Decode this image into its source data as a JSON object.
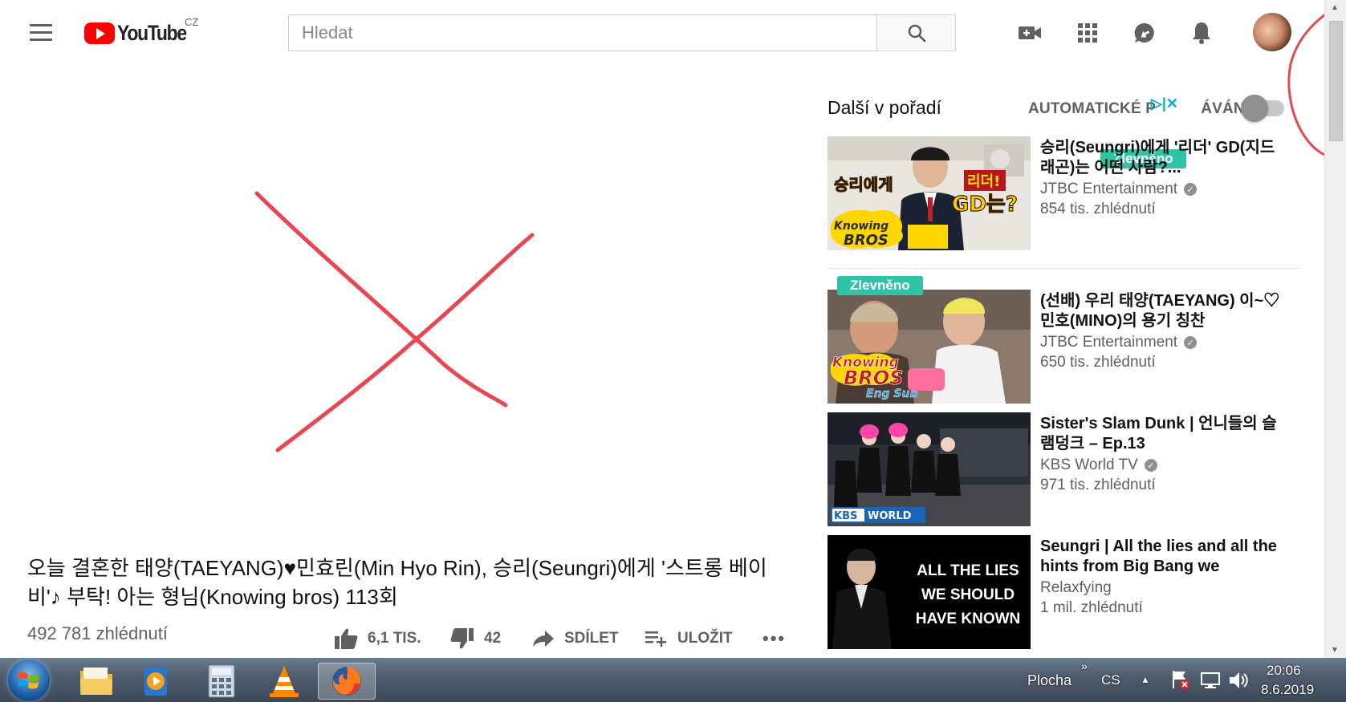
{
  "header": {
    "logo_text": "YouTube",
    "region": "CZ",
    "search_placeholder": "Hledat"
  },
  "video": {
    "title": "오늘 결혼한 태양(TAEYANG)♥민효린(Min Hyo Rin), 승리(Seungri)에게 '스트롱 베이비'♪ 부탁! 아는 형님(Knowing bros) 113회",
    "views": "492 781 zhlédnutí",
    "likes": "6,1 TIS.",
    "dislikes": "42",
    "share_label": "SDÍLET",
    "save_label": "ULOŽIT",
    "more_label": "•••"
  },
  "sidebar": {
    "up_next": "Další v pořadí",
    "autoplay_a": "AUTOMATICKÉ P",
    "autoplay_b": "ÁVÁNÍ",
    "autoplay_on": false,
    "items": [
      {
        "title": "승리(Seungri)에게 '리더' GD(지드래곤)는 어떤 사람?...",
        "channel": "JTBC Entertainment",
        "verified": true,
        "views": "854 tis. zhlédnutí",
        "badge": "Zlevněno",
        "thumb_text_1": "승리에게",
        "thumb_text_2": "리더!",
        "thumb_text_3": "GD는?",
        "thumb_logo": "Knowing BROS"
      },
      {
        "title": "(선배) 우리 태양(TAEYANG) 이~♡ 민호(MINO)의 용기 칭찬",
        "channel": "JTBC Entertainment",
        "verified": true,
        "views": "650 tis. zhlédnutí",
        "badge": "Zlevněno",
        "thumb_logo": "Knowing BROS",
        "thumb_sub": "Eng Sub"
      },
      {
        "title": "Sister's Slam Dunk | 언니들의 슬램덩크 – Ep.13",
        "channel": "KBS World TV",
        "verified": true,
        "views": "971 tis. zhlédnutí",
        "thumb_logo": "KBS WORLD"
      },
      {
        "title": "Seungri | All the lies and all the hints from Big Bang we",
        "channel": "Relaxfying",
        "verified": false,
        "views": "1 mil. zhlédnutí",
        "thumb_lines": [
          "ALL THE LIES",
          "WE SHOULD",
          "HAVE KNOWN"
        ]
      }
    ]
  },
  "taskbar": {
    "desktop_label": "Plocha",
    "language": "CS",
    "time": "20:06",
    "date": "8.6.2019"
  },
  "colors": {
    "brand": "#ff0000",
    "annotation": "#e8474f",
    "sale_badge": "#2ec4a5"
  }
}
